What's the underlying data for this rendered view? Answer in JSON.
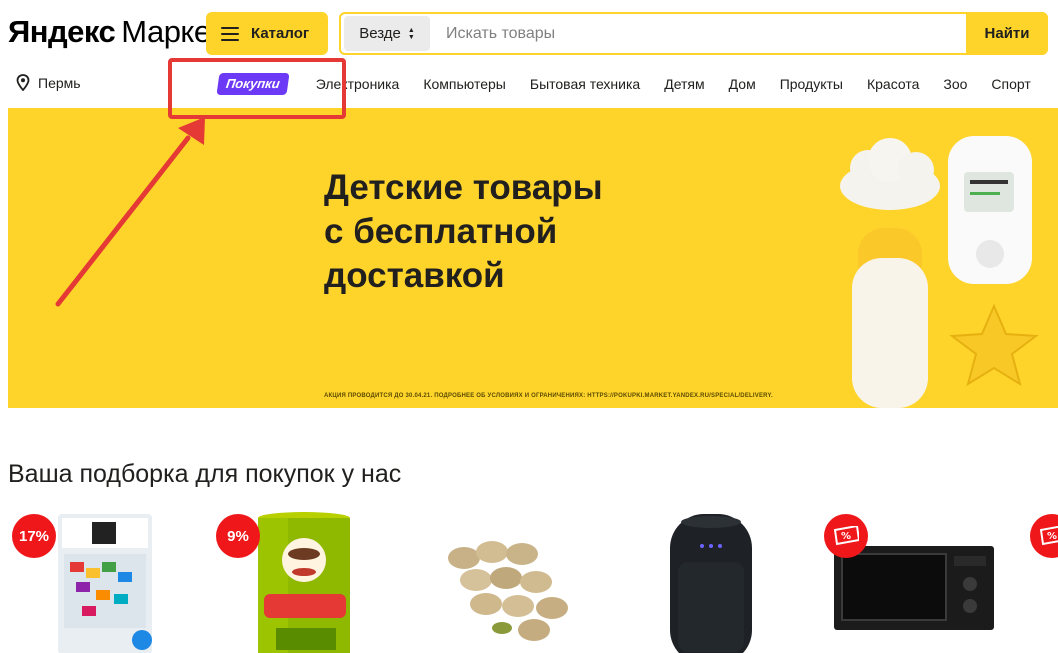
{
  "header": {
    "logo_bold": "Яндекс",
    "logo_light": "Маркет",
    "catalog_label": "Каталог",
    "search": {
      "scope": "Везде",
      "placeholder": "Искать товары",
      "button": "Найти"
    }
  },
  "region": "Пермь",
  "nav": {
    "promo": "Покупки",
    "items": [
      "Электроника",
      "Компьютеры",
      "Бытовая техника",
      "Детям",
      "Дом",
      "Продукты",
      "Красота",
      "Зоо",
      "Спорт"
    ]
  },
  "banner": {
    "title_lines": [
      "Детские товары",
      "с бесплатной",
      "доставкой"
    ],
    "disclaimer": "АКЦИЯ ПРОВОДИТСЯ ДО 30.04.21. ПОДРОБНЕЕ ОБ УСЛОВИЯХ И ОГРАНИЧЕНИЯХ: HTTPS://POKUPKI.MARKET.YANDEX.RU/SPECIAL/DELIVERY."
  },
  "section": {
    "title": "Ваша подборка для покупок у нас"
  },
  "products": [
    {
      "name": "iq-puzzle-game",
      "discount": "17%"
    },
    {
      "name": "pringles-sour-cream",
      "discount": "9%"
    },
    {
      "name": "pistachios",
      "discount": ""
    },
    {
      "name": "jbl-smart-speaker",
      "discount": ""
    },
    {
      "name": "microwave-oven",
      "discount": "coupon"
    },
    {
      "name": "partial-product",
      "discount": "coupon"
    }
  ],
  "colors": {
    "brand_yellow": "#fed42b",
    "promo_purple": "#6c39f7",
    "discount_red": "#f0171b",
    "annotation_red": "#e53935"
  }
}
